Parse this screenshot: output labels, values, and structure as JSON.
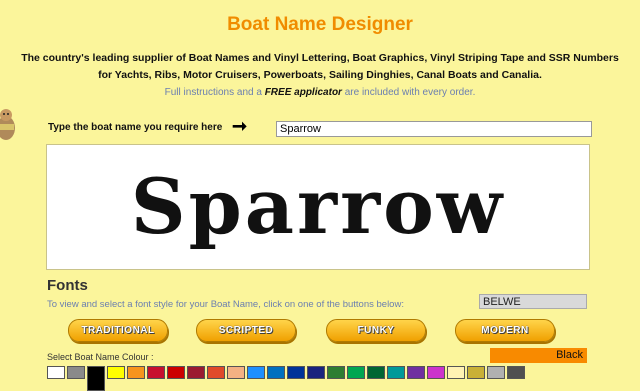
{
  "header": {
    "title": "Boat Name Designer",
    "tagline_line1": "The country's leading supplier of Boat Names and Vinyl Lettering, Boat Graphics, Vinyl Striping Tape and SSR Numbers",
    "tagline_line2": "for Yachts, Ribs, Motor Cruisers, Powerboats, Sailing Dinghies, Canal Boats and Canalia.",
    "info_before": "Full instructions and a ",
    "info_bold": "FREE applicator",
    "info_after": " are included with every order."
  },
  "name_entry": {
    "prompt": "Type the boat name you require here",
    "value": "Sparrow"
  },
  "preview": {
    "text": "Sparrow"
  },
  "fonts": {
    "heading": "Fonts",
    "instruction": "To view and select a font style for your Boat Name, click on one of the buttons below:",
    "selected_font": "BELWE",
    "buttons": [
      "TRADITIONAL",
      "SCRIPTED",
      "FUNKY",
      "MODERN"
    ]
  },
  "colour": {
    "label": "Select Boat Name Colour :",
    "selected": "Black",
    "selected_bg": "#f88a00",
    "swatches": [
      "#ffffff",
      "#8a8a8a",
      "#000000",
      "#ffff00",
      "#f7941d",
      "#c8102e",
      "#cc0000",
      "#9b1b30",
      "#e04a2a",
      "#f4b183",
      "#1e90ff",
      "#0070c0",
      "#003399",
      "#1a237e",
      "#2e7d32",
      "#00a651",
      "#006633",
      "#009999",
      "#7030a0",
      "#cc33cc",
      "#fff2b3",
      "#c9b037",
      "#b0b0b0",
      "#505050"
    ],
    "selected_index": 2
  }
}
